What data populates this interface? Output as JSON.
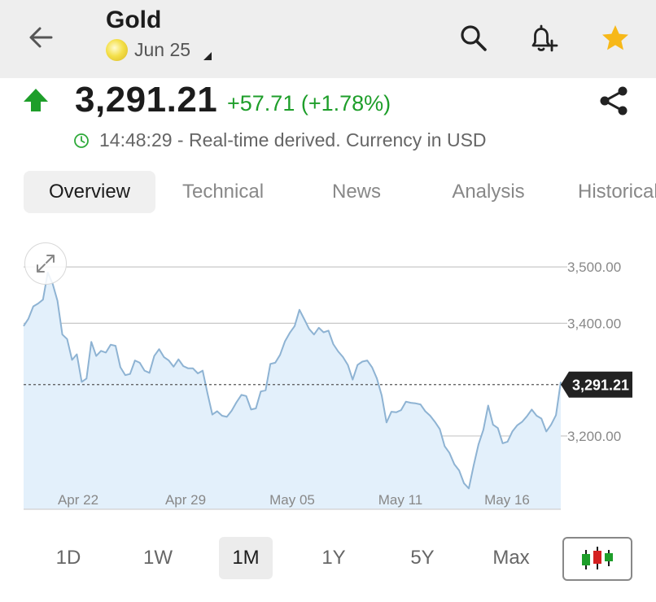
{
  "header": {
    "title": "Gold",
    "contract": "Jun 25"
  },
  "quote": {
    "price": "3,291.21",
    "change": "+57.71 (+1.78%)",
    "meta": "14:48:29 - Real-time derived. Currency in USD"
  },
  "tabs": [
    {
      "label": "Overview",
      "active": true
    },
    {
      "label": "Technical"
    },
    {
      "label": "News"
    },
    {
      "label": "Analysis"
    },
    {
      "label": "Historical"
    }
  ],
  "chart_data": {
    "type": "area",
    "y_ticks": [
      "3,500.00",
      "3,400.00",
      "3,200.00"
    ],
    "y_tick_values": [
      3500,
      3400,
      3200
    ],
    "x_ticks": [
      "Apr 22",
      "Apr 29",
      "May 05",
      "May 11",
      "May 16"
    ],
    "ylim": [
      3070,
      3555
    ],
    "current_value": 3291.21,
    "current_label": "3,291.21",
    "values": [
      3395,
      3408,
      3430,
      3435,
      3442,
      3490,
      3470,
      3440,
      3380,
      3372,
      3335,
      3345,
      3296,
      3302,
      3367,
      3342,
      3351,
      3348,
      3362,
      3360,
      3322,
      3308,
      3310,
      3334,
      3330,
      3316,
      3312,
      3342,
      3354,
      3340,
      3334,
      3323,
      3336,
      3324,
      3320,
      3320,
      3311,
      3316,
      3276,
      3238,
      3244,
      3236,
      3234,
      3245,
      3260,
      3273,
      3271,
      3247,
      3249,
      3279,
      3281,
      3328,
      3330,
      3344,
      3368,
      3383,
      3395,
      3424,
      3407,
      3390,
      3380,
      3392,
      3384,
      3387,
      3363,
      3350,
      3340,
      3326,
      3300,
      3326,
      3332,
      3334,
      3322,
      3302,
      3272,
      3224,
      3243,
      3242,
      3246,
      3261,
      3259,
      3258,
      3256,
      3244,
      3236,
      3225,
      3212,
      3182,
      3170,
      3150,
      3139,
      3116,
      3107,
      3148,
      3185,
      3211,
      3254,
      3220,
      3214,
      3187,
      3190,
      3208,
      3219,
      3225,
      3235,
      3247,
      3236,
      3231,
      3208,
      3220,
      3237,
      3296
    ]
  },
  "ranges": [
    {
      "label": "1D"
    },
    {
      "label": "1W"
    },
    {
      "label": "1M",
      "active": true
    },
    {
      "label": "1Y"
    },
    {
      "label": "5Y"
    },
    {
      "label": "Max"
    }
  ],
  "colors": {
    "up": "#1e9e2a",
    "line": "#8eb3d3",
    "fill": "#e3f0fb",
    "star": "#f7b818",
    "price_tag": "#222222"
  },
  "icons": [
    "back-arrow-icon",
    "search-icon",
    "add-alert-bell-icon",
    "star-icon",
    "up-arrow-icon",
    "share-icon",
    "clock-icon",
    "expand-icon",
    "candlestick-icon"
  ]
}
